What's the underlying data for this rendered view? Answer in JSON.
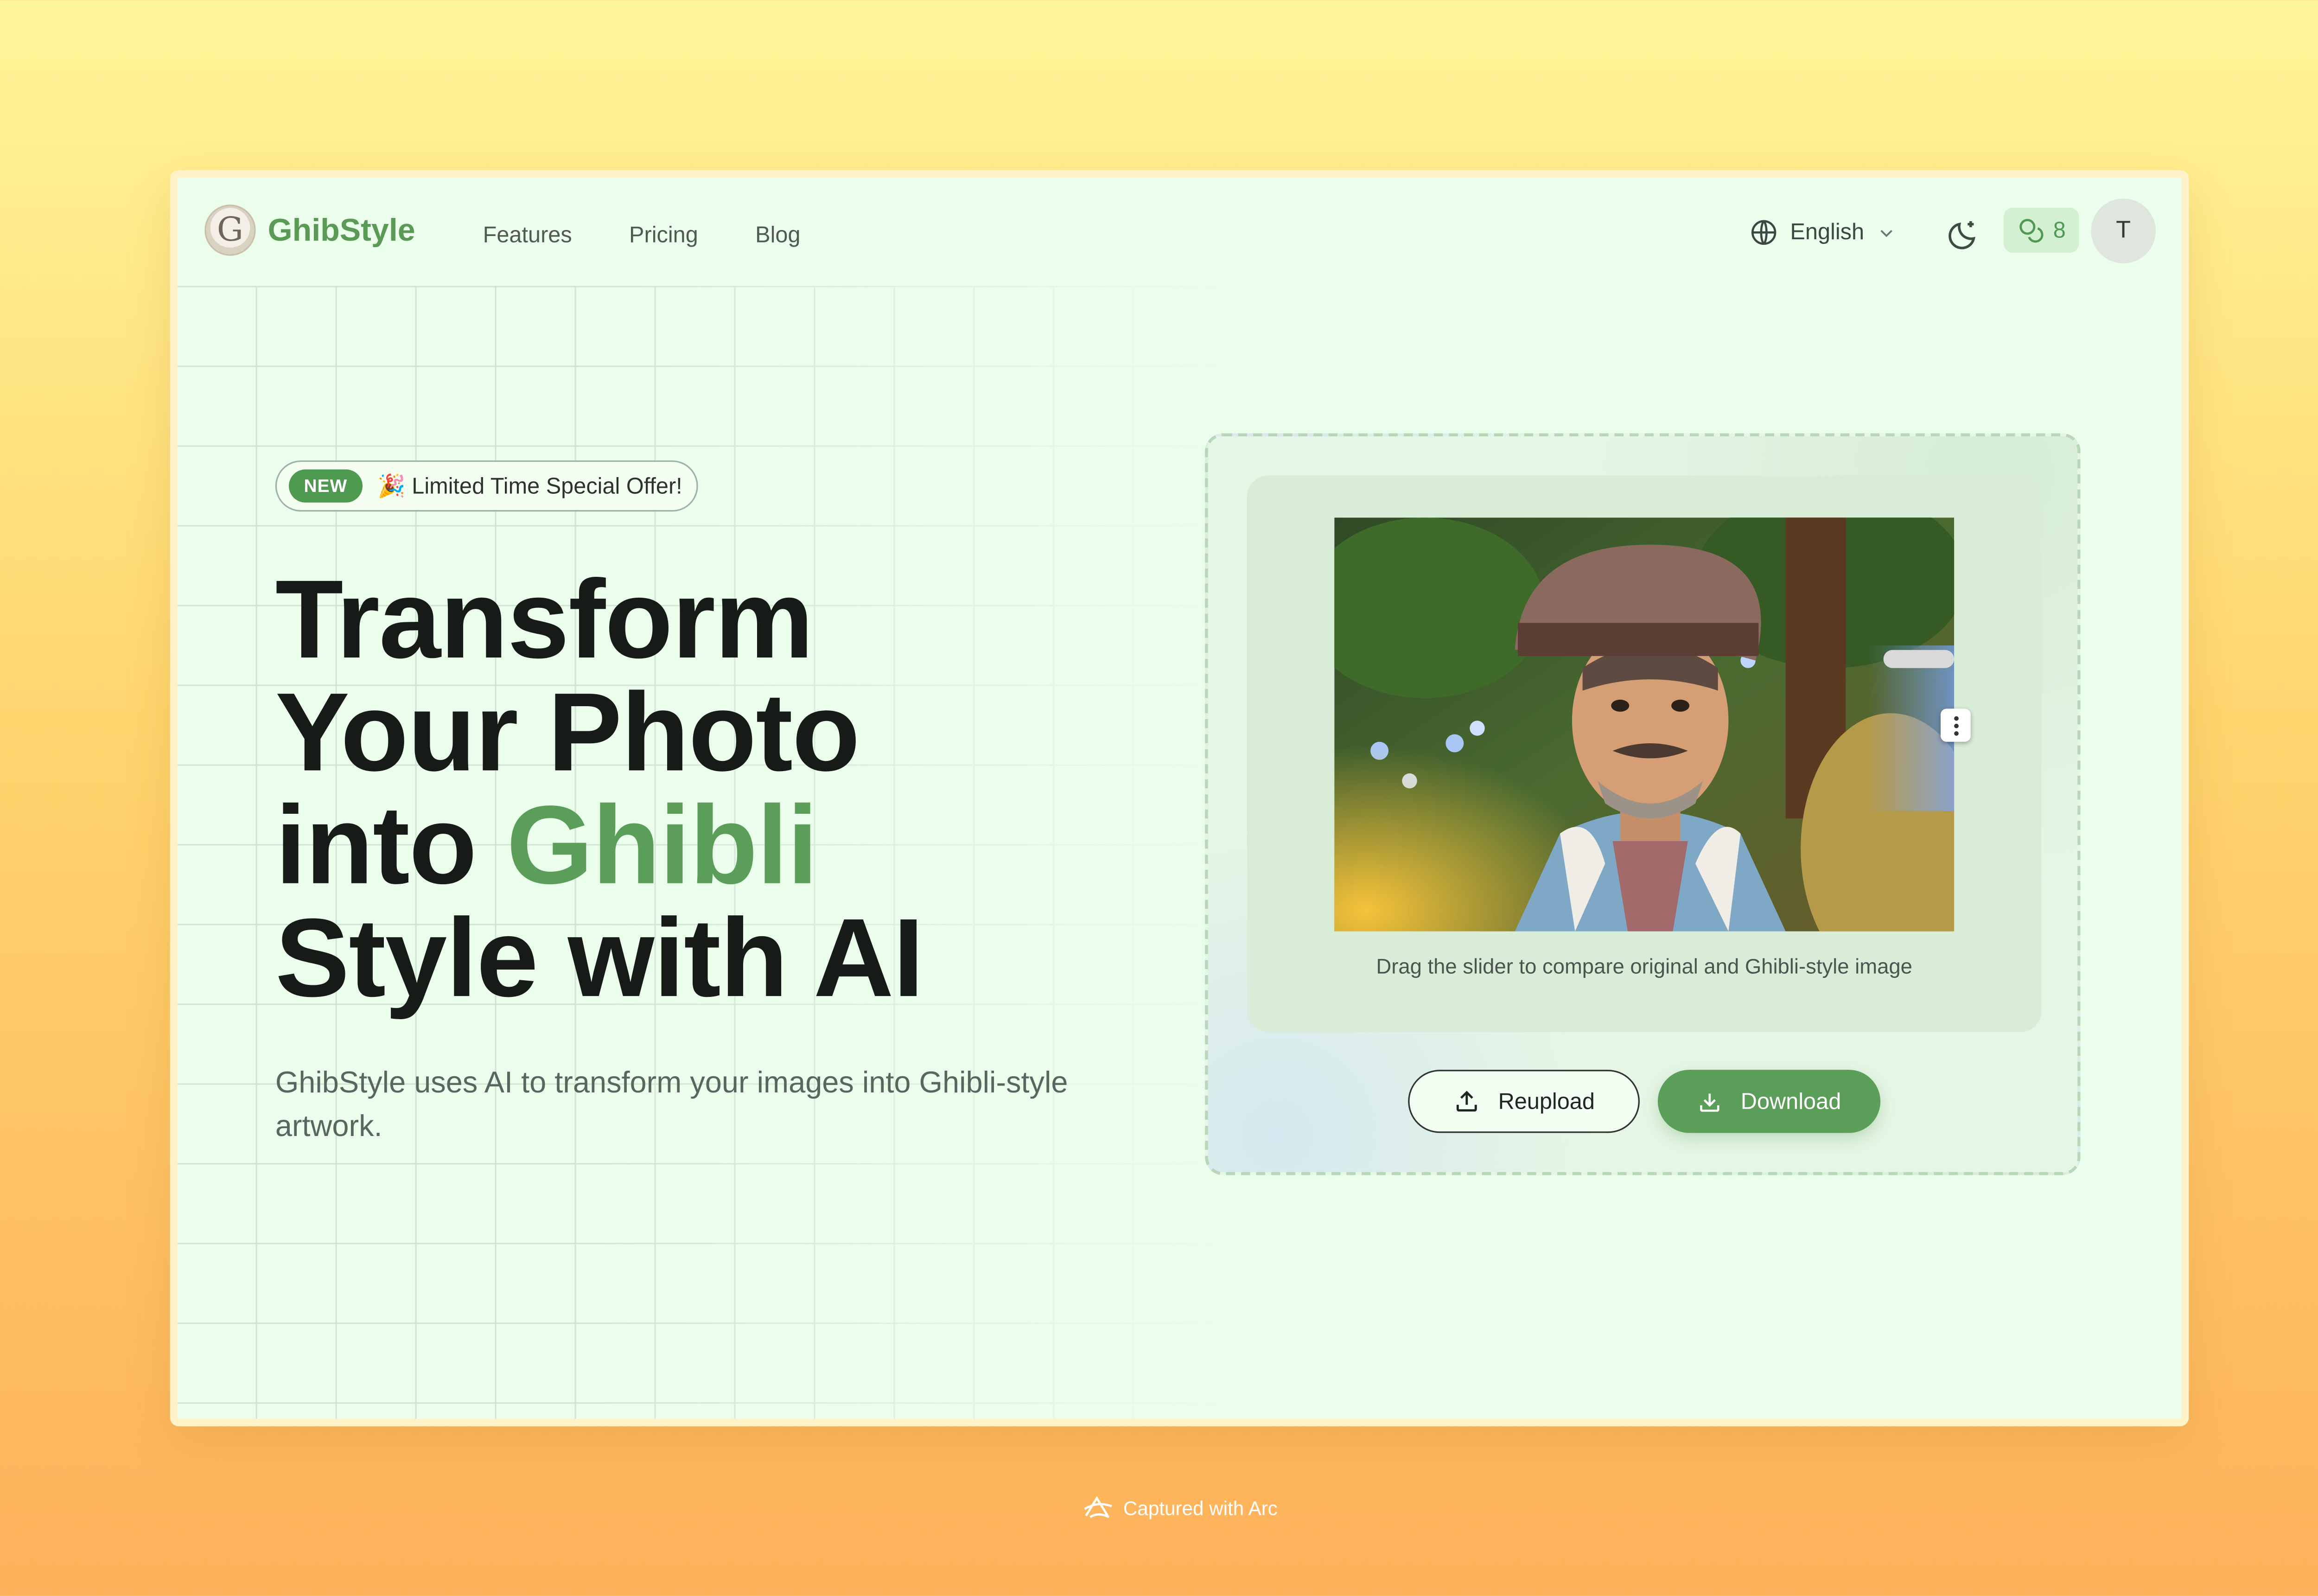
{
  "header": {
    "brand": "GhibStyle",
    "logo_glyph": "G",
    "nav": [
      "Features",
      "Pricing",
      "Blog"
    ],
    "language": "English",
    "credits": "8",
    "avatar_initial": "T"
  },
  "hero": {
    "badge_new": "NEW",
    "badge_offer": "🎉 Limited Time Special Offer!",
    "headline_line1": "Transform",
    "headline_line2": "Your Photo",
    "headline_line3_plain": "into",
    "headline_line3_accent": "Ghibli",
    "headline_line4": "Style with AI",
    "subtitle": "GhibStyle uses AI to transform your images into Ghibli-style artwork."
  },
  "demo": {
    "caption": "Drag the slider to compare original and Ghibli-style image",
    "reupload_label": "Reupload",
    "download_label": "Download"
  },
  "footer": {
    "capture_text": "Captured with Arc"
  },
  "colors": {
    "accent": "#5a9e59",
    "window_bg": "#ebfdeb"
  }
}
